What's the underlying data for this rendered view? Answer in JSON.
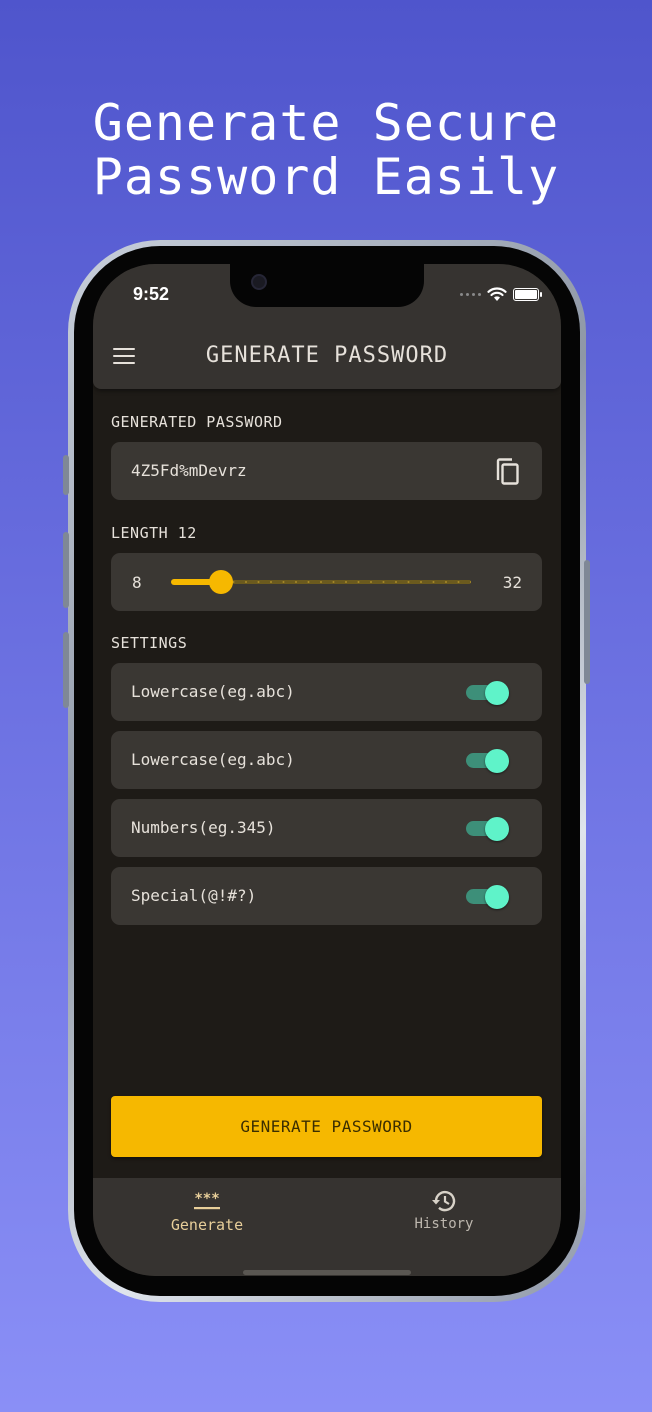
{
  "headline": {
    "line1": "Generate Secure",
    "line2": "Password Easily"
  },
  "status_bar": {
    "time": "9:52"
  },
  "appbar": {
    "title": "GENERATE PASSWORD"
  },
  "generated": {
    "label": "GENERATED PASSWORD",
    "value": "4Z5Fd%mDevrz"
  },
  "length": {
    "label": "LENGTH 12",
    "min": "8",
    "max": "32",
    "current": 12
  },
  "settings": {
    "label": "SETTINGS",
    "items": [
      {
        "label": "Lowercase(eg.abc)",
        "on": true
      },
      {
        "label": "Lowercase(eg.abc)",
        "on": true
      },
      {
        "label": "Numbers(eg.345)",
        "on": true
      },
      {
        "label": "Special(@!#?)",
        "on": true
      }
    ]
  },
  "button": {
    "label": "GENERATE PASSWORD"
  },
  "bottom_nav": {
    "items": [
      {
        "label": "Generate",
        "icon": "asterisk-password-icon",
        "active": true
      },
      {
        "label": "History",
        "icon": "history-icon",
        "active": false
      }
    ]
  },
  "colors": {
    "accent": "#f6b800",
    "toggle_on": "#5ff3c9",
    "background_top": "#4f55cc",
    "background_bottom": "#8a8ff6",
    "surface": "#1e1b17",
    "card": "#3a3733"
  }
}
